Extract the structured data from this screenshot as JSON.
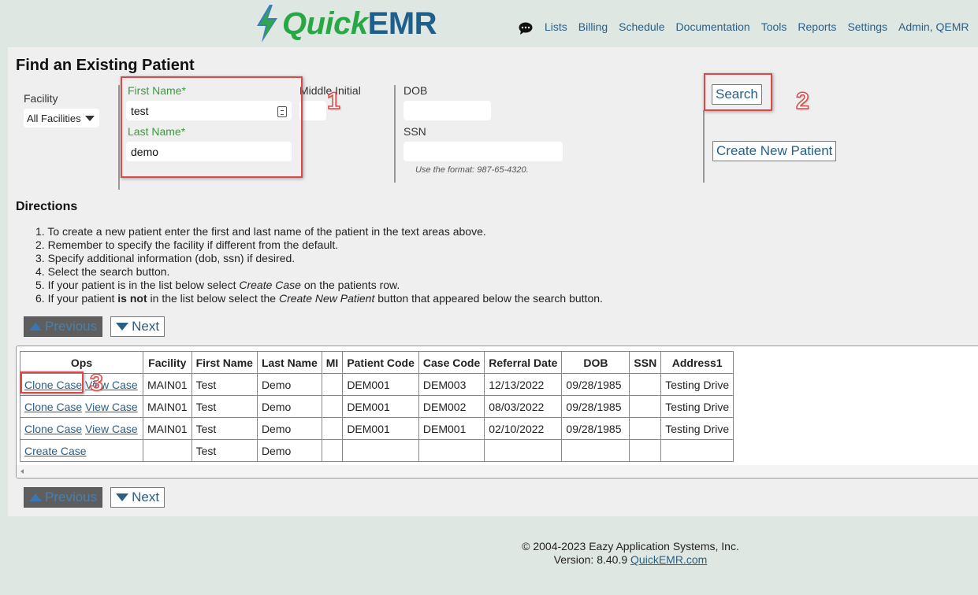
{
  "header": {
    "brand_quick": "Quick",
    "brand_emr": "EMR",
    "nav": [
      "Lists",
      "Billing",
      "Schedule",
      "Documentation",
      "Tools",
      "Reports",
      "Settings",
      "Admin, QEMR"
    ]
  },
  "page": {
    "title": "Find an Existing Patient"
  },
  "form": {
    "facility_label": "Facility",
    "facility_value": "All Facilities",
    "first_name_label": "First Name*",
    "first_name_value": "test",
    "last_name_label": "Last Name*",
    "last_name_value": "demo",
    "middle_initial_label": "Middle Initial",
    "middle_initial_value": "",
    "dob_label": "DOB",
    "dob_value": "",
    "ssn_label": "SSN",
    "ssn_value": "",
    "ssn_hint": "Use the format: 987-65-4320.",
    "search_label": "Search",
    "create_label": "Create New Patient"
  },
  "annotations": [
    "1",
    "2",
    "3"
  ],
  "directions": {
    "title": "Directions",
    "steps": [
      "1. To create a new patient enter the first and last name of the patient in the text areas above.",
      "2. Remember to specify the facility if different from the default.",
      "3. Specify additional information (dob, ssn) if desired.",
      "4. Select the search button.",
      "5. If your patient is in the list below select <i>Create Case</i> on the patients row.",
      "6. If your patient <b>is not</b> in the list below select the <i>Create New Patient</i> button that appeared below the search button."
    ]
  },
  "pager": {
    "previous": "Previous",
    "next": "Next"
  },
  "table": {
    "headers": [
      "Ops",
      "Facility",
      "First Name",
      "Last Name",
      "MI",
      "Patient Code",
      "Case Code",
      "Referral Date",
      "DOB",
      "SSN",
      "Address1"
    ],
    "rows": [
      {
        "ops": [
          "Clone Case",
          "View Case"
        ],
        "cells": [
          "MAIN01",
          "Test",
          "Demo",
          "",
          "DEM001",
          "DEM003",
          "12/13/2022",
          "09/28/1985",
          "",
          "Testing Drive"
        ]
      },
      {
        "ops": [
          "Clone Case",
          "View Case"
        ],
        "cells": [
          "MAIN01",
          "Test",
          "Demo",
          "",
          "DEM001",
          "DEM002",
          "08/03/2022",
          "09/28/1985",
          "",
          "Testing Drive"
        ]
      },
      {
        "ops": [
          "Clone Case",
          "View Case"
        ],
        "cells": [
          "MAIN01",
          "Test",
          "Demo",
          "",
          "DEM001",
          "DEM001",
          "02/10/2022",
          "09/28/1985",
          "",
          "Testing Drive"
        ]
      },
      {
        "ops": [
          "Create Case"
        ],
        "cells": [
          "",
          "Test",
          "Demo",
          "",
          "",
          "",
          "",
          "",
          "",
          ""
        ]
      }
    ]
  },
  "footer": {
    "copyright": "© 2004-2023 Eazy Application Systems, Inc.",
    "version_prefix": "Version: 8.40.9",
    "link": "QuickEMR.com"
  },
  "colors": {
    "brand_green": "#27a844",
    "brand_blue": "#1f5f8b",
    "link": "#2a5f86",
    "annotation_red": "#e04848"
  }
}
